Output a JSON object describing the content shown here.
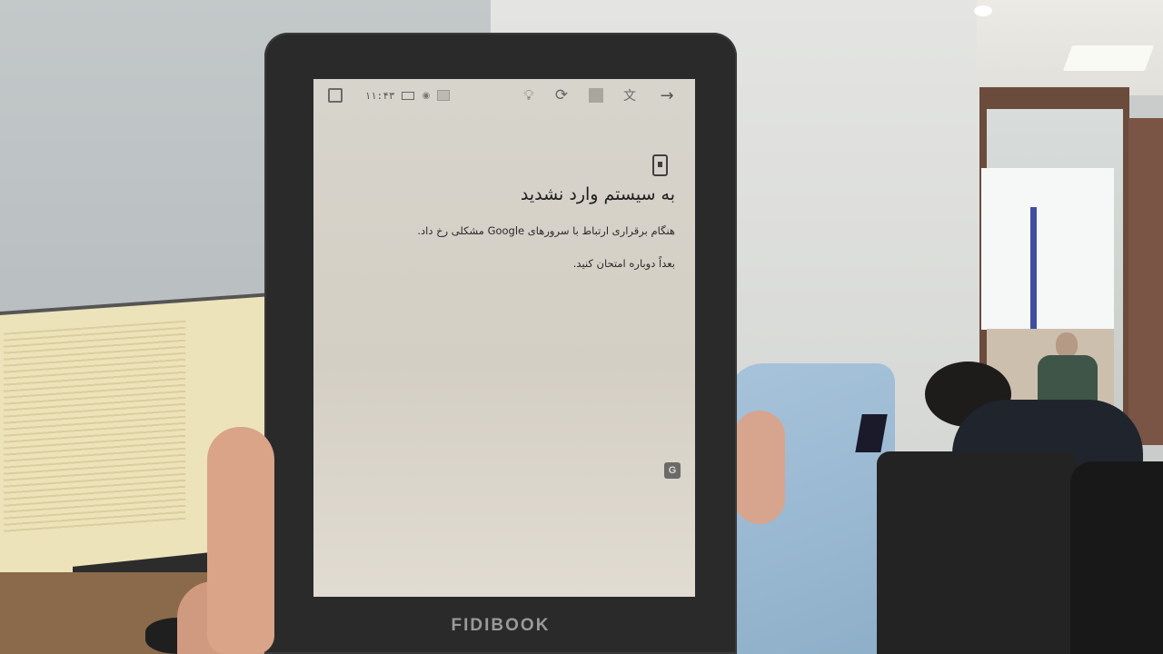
{
  "device": {
    "brand": "FIDIBOOK"
  },
  "status_bar": {
    "time": "۱۱:۴۳",
    "icons": [
      "copy-icon",
      "battery-icon",
      "wifi-icon",
      "screen-icon",
      "frontlight-icon",
      "sync-icon",
      "grid-icon",
      "language-icon",
      "back-arrow-icon"
    ]
  },
  "dialog": {
    "icon": "phone-icon",
    "title": "به سیستم وارد نشدید",
    "message": "هنگام برقراری ارتباط با سرورهای Google مشکلی رخ داد.",
    "retry_hint": "بعداً دوباره امتحان کنید."
  },
  "corner_icon": "google-translate-icon"
}
